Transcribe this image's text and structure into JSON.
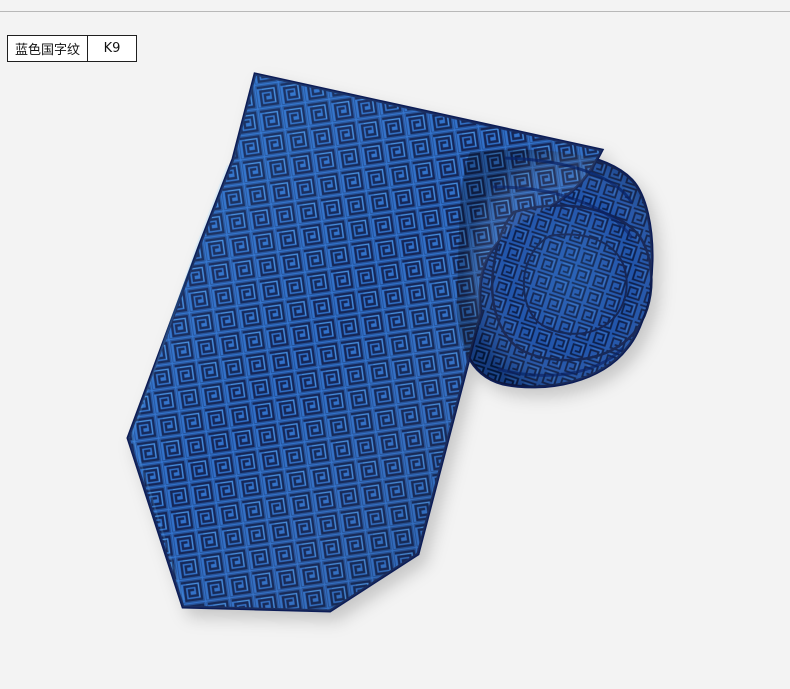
{
  "product_label": {
    "name": "蓝色国字纹",
    "code": "K9"
  },
  "image": {
    "subject": "tie-photo",
    "colors": {
      "background": "#f3f3f3",
      "tie_blue": "#1f66c8",
      "tie_dark": "#0b1f56",
      "tie_highlight": "#57b0ff"
    }
  }
}
